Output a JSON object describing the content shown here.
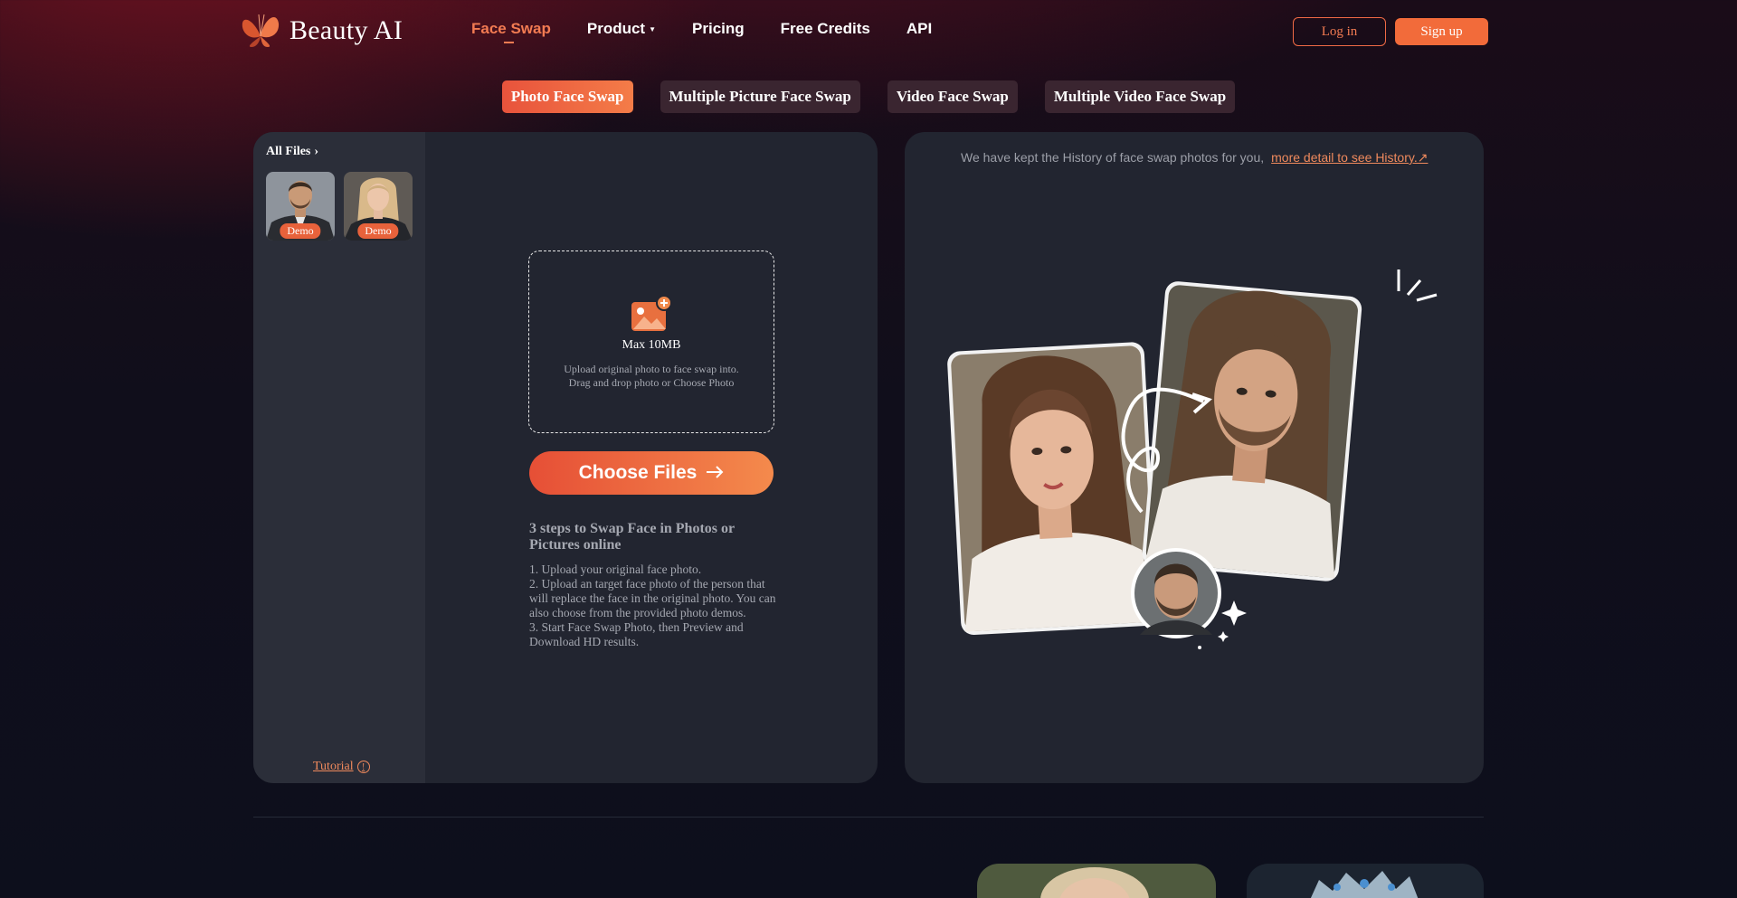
{
  "nav": {
    "logo_text": "Beauty AI",
    "links": [
      {
        "label": "Face Swap",
        "active": true
      },
      {
        "label": "Product",
        "has_caret": true
      },
      {
        "label": "Pricing"
      },
      {
        "label": "Free Credits"
      },
      {
        "label": "API"
      }
    ],
    "login": "Log in",
    "signup": "Sign up"
  },
  "tabs": [
    {
      "label": "Photo Face Swap",
      "active": true
    },
    {
      "label": "Multiple Picture Face Swap"
    },
    {
      "label": "Video Face Swap"
    },
    {
      "label": "Multiple Video Face Swap"
    }
  ],
  "sidebar": {
    "all_files": "All Files",
    "thumbs": [
      {
        "badge": "Demo"
      },
      {
        "badge": "Demo"
      }
    ],
    "tutorial": "Tutorial"
  },
  "upload": {
    "max": "Max 10MB",
    "desc1": "Upload original photo to face swap into.",
    "desc2": "Drag and drop photo or Choose Photo",
    "button": "Choose Files",
    "steps_title": "3 steps to Swap Face in Photos or Pictures online",
    "steps": [
      "1. Upload your original face photo.",
      "2. Upload an target face photo of the person that will replace the face in the original photo. You can also choose from the provided photo demos.",
      "3. Start Face Swap Photo, then Preview and Download HD results."
    ]
  },
  "history": {
    "note": "We have kept the History of face swap photos for you,",
    "link": "more detail to see History.↗"
  },
  "colors": {
    "accent": "#f26b3a",
    "panel": "#222530",
    "sidebar": "#2b2e39"
  }
}
